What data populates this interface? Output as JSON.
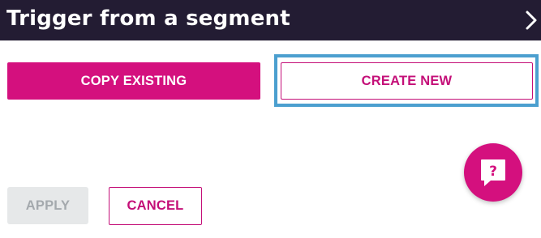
{
  "header": {
    "title": "Trigger from a segment",
    "chevron_icon": "chevron-right-icon"
  },
  "actions": {
    "copy_existing_label": "COPY EXISTING",
    "create_new_label": "CREATE NEW"
  },
  "footer": {
    "apply_label": "APPLY",
    "apply_disabled": true,
    "cancel_label": "CANCEL"
  },
  "help": {
    "icon": "help-chat-icon",
    "glyph": "?"
  },
  "colors": {
    "header_bg": "#231c33",
    "accent": "#d4107e",
    "focus": "#4b9fcf",
    "disabled_bg": "#e6e8e9",
    "disabled_text": "#a4a9ad"
  }
}
